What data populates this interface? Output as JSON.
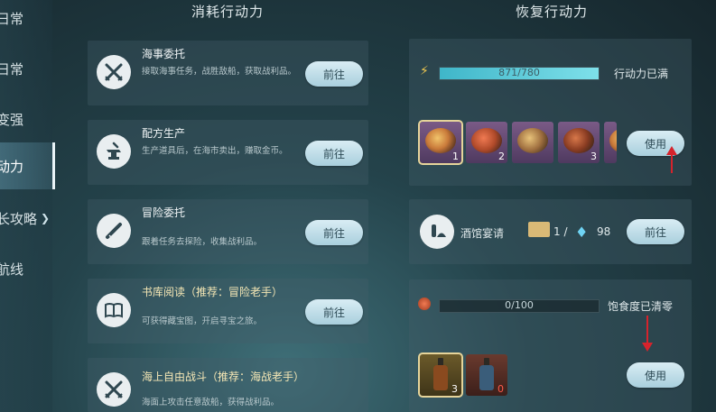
{
  "sidebar": {
    "items": [
      {
        "label": "日常"
      },
      {
        "label": "日常"
      },
      {
        "label": "变强"
      },
      {
        "label": "动力"
      },
      {
        "label": "长攻略"
      },
      {
        "label": "航线"
      }
    ]
  },
  "columns": {
    "left_title": "消耗行动力",
    "right_title": "恢复行动力"
  },
  "tasks": [
    {
      "title": "海事委托",
      "desc": "接取海事任务，战胜敌船，获取战利品。",
      "button": "前往",
      "icon": "crossed-swords-icon"
    },
    {
      "title": "配方生产",
      "desc": "生产道具后，在海市卖出，赚取金币。",
      "button": "前往",
      "icon": "anvil-icon"
    },
    {
      "title": "冒险委托",
      "desc": "跟着任务去探险，收集战利品。",
      "button": "前往",
      "icon": "spyglass-icon"
    },
    {
      "title": "书库阅读（推荐：冒险老手）",
      "desc": "可获得藏宝图，开启寻宝之旅。",
      "button": "前往",
      "icon": "book-icon"
    },
    {
      "title": "海上自由战斗（推荐：海战老手）",
      "desc": "海面上攻击任意敌船，获得战利品。",
      "button": "前往",
      "icon": "crossed-swords-icon"
    }
  ],
  "stamina": {
    "bar_text": "871/780",
    "progress": 1.0,
    "status": "行动力已满",
    "accent": "#5cc8d8"
  },
  "food": {
    "items": [
      {
        "qty": "1"
      },
      {
        "qty": "2"
      },
      {
        "qty": ""
      },
      {
        "qty": "3"
      },
      {
        "qty": ""
      }
    ],
    "use_label": "使用"
  },
  "tavern": {
    "label": "酒馆宴请",
    "count": "1 /",
    "gems": "98",
    "button": "前往"
  },
  "satiety": {
    "bar_text": "0/100",
    "progress": 0.0,
    "status": "饱食度已清零"
  },
  "drinks": {
    "items": [
      {
        "qty": "3",
        "color": "#8a4a1f"
      },
      {
        "qty": "0",
        "color": "#3a5d7a"
      }
    ],
    "use_label": "使用"
  }
}
